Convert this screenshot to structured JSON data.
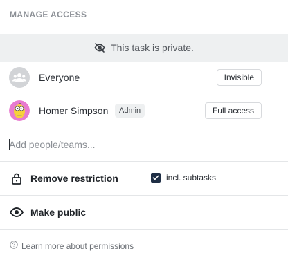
{
  "header": {
    "title": "MANAGE ACCESS"
  },
  "banner": {
    "icon": "eye-off-icon",
    "text": "This task is private."
  },
  "members": [
    {
      "name": "Everyone",
      "avatar": "group-icon",
      "badge": "",
      "permission": "Invisible"
    },
    {
      "name": "Homer Simpson",
      "avatar": "homer-avatar",
      "badge": "Admin",
      "permission": "Full access"
    }
  ],
  "add_people": {
    "placeholder": "Add people/teams...",
    "value": ""
  },
  "remove_restriction": {
    "icon": "lock-icon",
    "label": "Remove restriction"
  },
  "subtasks_checkbox": {
    "label": "incl. subtasks",
    "checked": true
  },
  "make_public": {
    "icon": "eye-icon",
    "label": "Make public"
  },
  "footer": {
    "icon": "help-circle-icon",
    "link_text": "Learn more about permissions"
  },
  "colors": {
    "checkbox": "#1f2e45",
    "banner_bg": "#eef0f1",
    "divider": "#e4e6e8"
  }
}
